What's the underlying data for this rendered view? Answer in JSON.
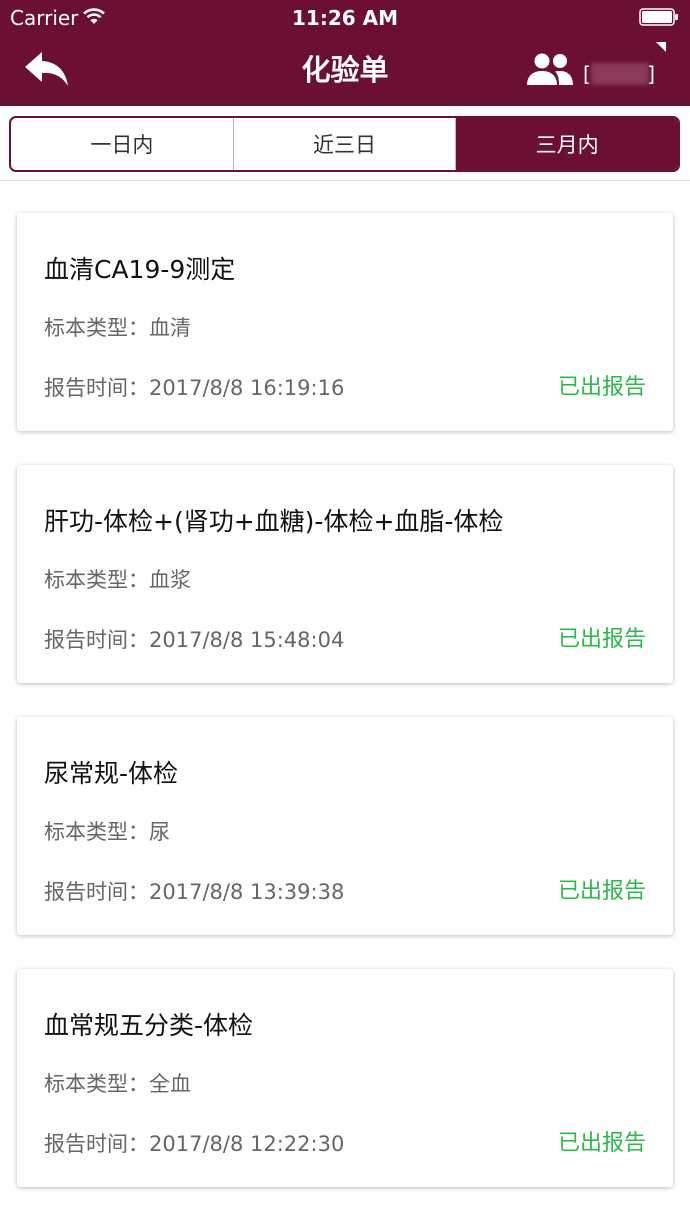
{
  "status_bar": {
    "carrier": "Carrier",
    "time": "11:26 AM"
  },
  "header": {
    "title": "化验单",
    "back_icon": "back-arrow-icon",
    "user_icon": "user-group-icon",
    "bracket_left": "[",
    "bracket_right": "]"
  },
  "tabs": [
    {
      "label": "一日内",
      "active": false
    },
    {
      "label": "近三日",
      "active": false
    },
    {
      "label": "三月内",
      "active": true
    }
  ],
  "reports": [
    {
      "name": "血清CA19-9测定",
      "specimen_label": "标本类型：",
      "specimen": "血清",
      "time_label": "报告时间：",
      "time": "2017/8/8 16:19:16",
      "status": "已出报告"
    },
    {
      "name": "肝功-体检+(肾功+血糖)-体检+血脂-体检",
      "specimen_label": "标本类型：",
      "specimen": "血浆",
      "time_label": "报告时间：",
      "time": "2017/8/8 15:48:04",
      "status": "已出报告"
    },
    {
      "name": "尿常规-体检",
      "specimen_label": "标本类型：",
      "specimen": "尿",
      "time_label": "报告时间：",
      "time": "2017/8/8 13:39:38",
      "status": "已出报告"
    },
    {
      "name": "血常规五分类-体检",
      "specimen_label": "标本类型：",
      "specimen": "全血",
      "time_label": "报告时间：",
      "time": "2017/8/8 12:22:30",
      "status": "已出报告"
    }
  ],
  "colors": {
    "brand": "#6b0f33",
    "status_green": "#2db84a"
  }
}
